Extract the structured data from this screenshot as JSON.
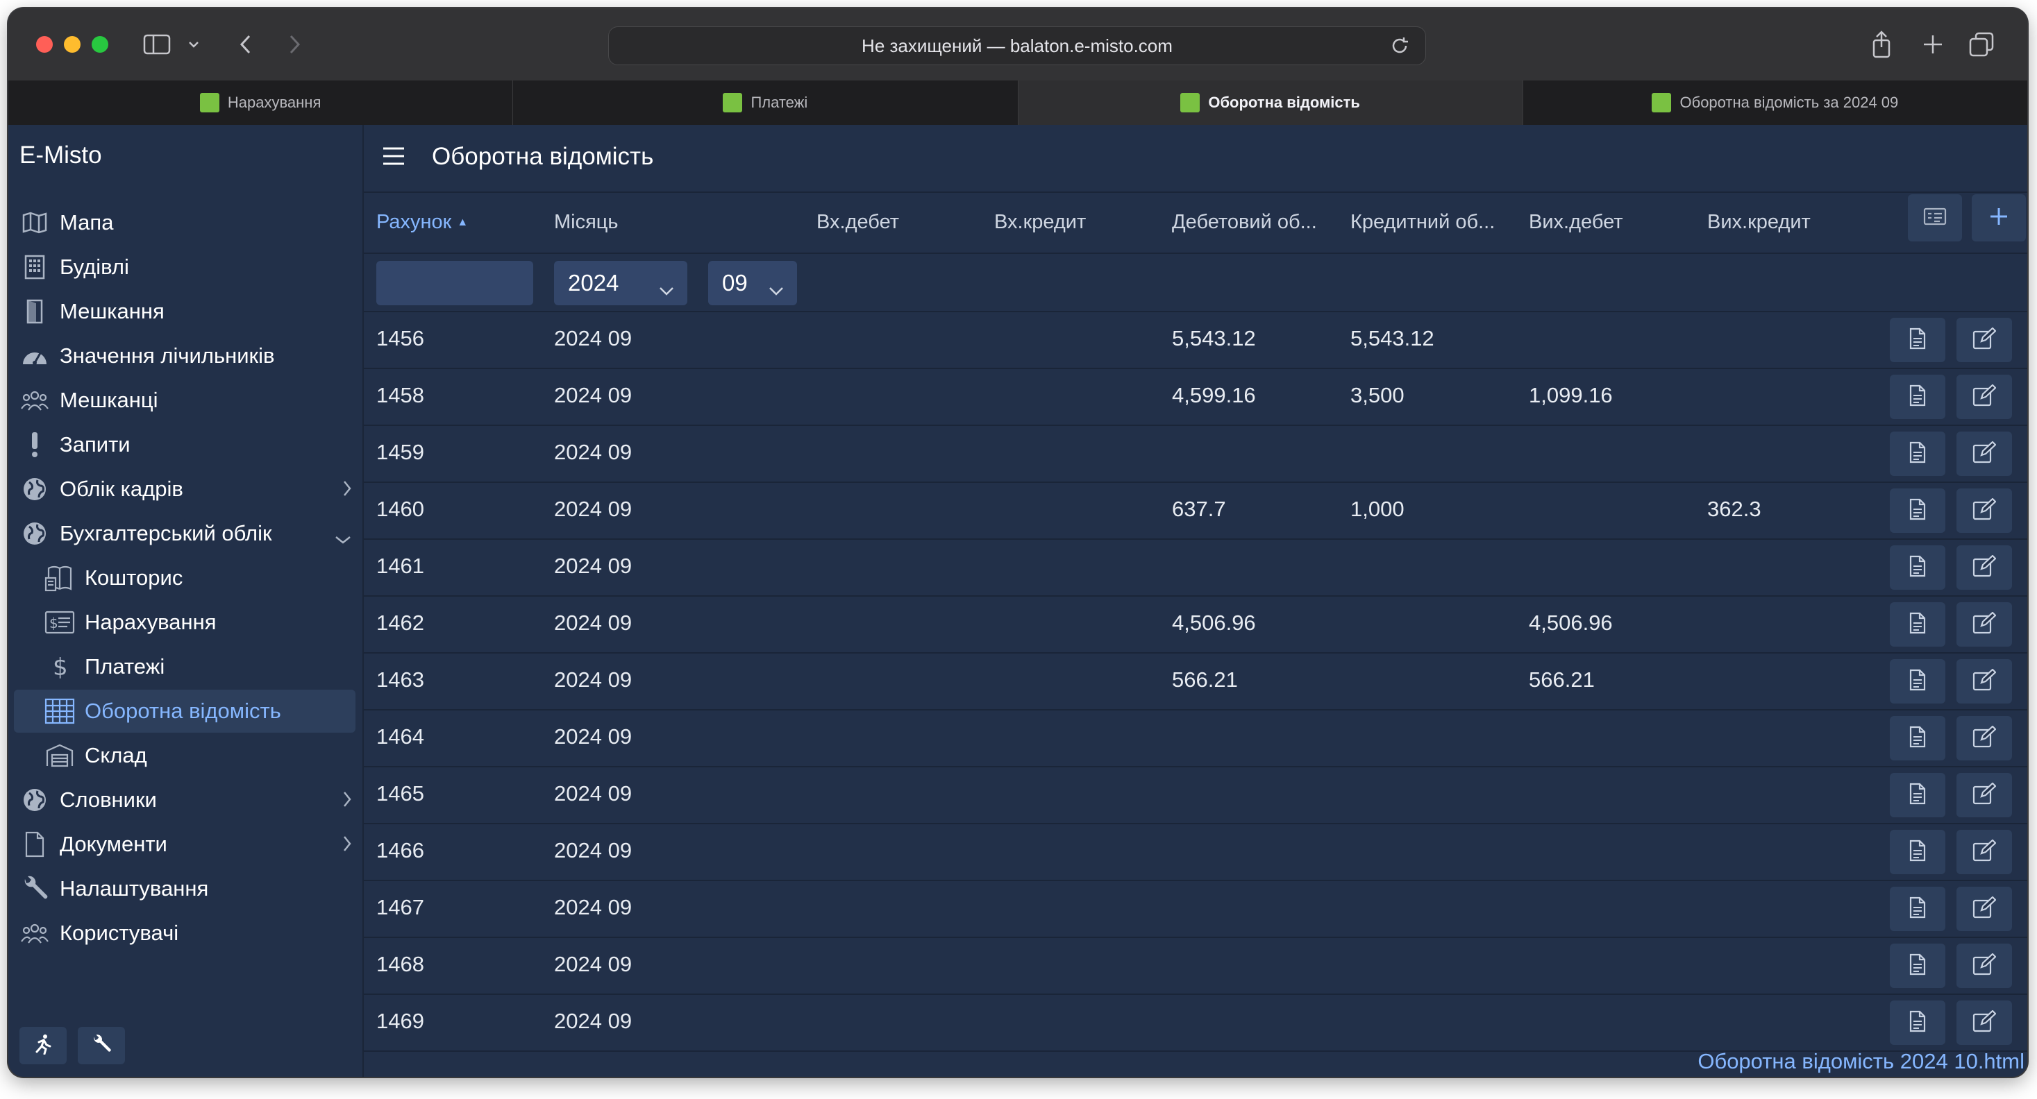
{
  "browser": {
    "url_text": "Не захищений — balaton.e-misto.com",
    "tabs": [
      {
        "label": "Нарахування",
        "active": false
      },
      {
        "label": "Платежі",
        "active": false
      },
      {
        "label": "Оборотна відомість",
        "active": true
      },
      {
        "label": "Оборотна відомість за 2024 09",
        "active": false
      }
    ]
  },
  "sidebar": {
    "brand": "E-Misto",
    "items": [
      {
        "label": "Мапа",
        "icon": "map-icon"
      },
      {
        "label": "Будівлі",
        "icon": "building-icon"
      },
      {
        "label": "Мешкання",
        "icon": "door-icon"
      },
      {
        "label": "Значення лічильників",
        "icon": "gauge-icon"
      },
      {
        "label": "Мешканці",
        "icon": "users-icon"
      },
      {
        "label": "Запити",
        "icon": "exclamation-icon"
      },
      {
        "label": "Облік кадрів",
        "icon": "globe-icon",
        "chevron": "right"
      },
      {
        "label": "Бухгалтерський облік",
        "icon": "globe-icon",
        "chevron": "down"
      },
      {
        "label": "Кошторис",
        "icon": "book-icon",
        "sub": true
      },
      {
        "label": "Нарахування",
        "icon": "invoice-icon",
        "sub": true
      },
      {
        "label": "Платежі",
        "icon": "dollar-icon",
        "sub": true
      },
      {
        "label": "Оборотна відомість",
        "icon": "table-icon",
        "sub": true,
        "active": true
      },
      {
        "label": "Склад",
        "icon": "warehouse-icon",
        "sub": true
      },
      {
        "label": "Словники",
        "icon": "globe-icon",
        "chevron": "right"
      },
      {
        "label": "Документи",
        "icon": "document-icon",
        "chevron": "right"
      },
      {
        "label": "Налаштування",
        "icon": "wrench-icon"
      },
      {
        "label": "Користувачі",
        "icon": "users-icon"
      }
    ],
    "bottom_buttons": [
      "run-icon",
      "wrench-icon"
    ]
  },
  "page": {
    "title": "Оборотна відомість",
    "columns": [
      "Рахунок",
      "Місяць",
      "Вх.дебет",
      "Вх.кредит",
      "Дебетовий об...",
      "Кредитний об...",
      "Вих.дебет",
      "Вих.кредит"
    ],
    "sorted_column": "Рахунок",
    "filters": {
      "account": "",
      "year": "2024",
      "month": "09"
    },
    "rows": [
      {
        "account": "1456",
        "month": "2024 09",
        "in_debit": "",
        "in_credit": "",
        "debit_turnover": "5,543.12",
        "credit_turnover": "5,543.12",
        "out_debit": "",
        "out_credit": ""
      },
      {
        "account": "1458",
        "month": "2024 09",
        "in_debit": "",
        "in_credit": "",
        "debit_turnover": "4,599.16",
        "credit_turnover": "3,500",
        "out_debit": "1,099.16",
        "out_credit": ""
      },
      {
        "account": "1459",
        "month": "2024 09",
        "in_debit": "",
        "in_credit": "",
        "debit_turnover": "",
        "credit_turnover": "",
        "out_debit": "",
        "out_credit": ""
      },
      {
        "account": "1460",
        "month": "2024 09",
        "in_debit": "",
        "in_credit": "",
        "debit_turnover": "637.7",
        "credit_turnover": "1,000",
        "out_debit": "",
        "out_credit": "362.3"
      },
      {
        "account": "1461",
        "month": "2024 09",
        "in_debit": "",
        "in_credit": "",
        "debit_turnover": "",
        "credit_turnover": "",
        "out_debit": "",
        "out_credit": ""
      },
      {
        "account": "1462",
        "month": "2024 09",
        "in_debit": "",
        "in_credit": "",
        "debit_turnover": "4,506.96",
        "credit_turnover": "",
        "out_debit": "4,506.96",
        "out_credit": ""
      },
      {
        "account": "1463",
        "month": "2024 09",
        "in_debit": "",
        "in_credit": "",
        "debit_turnover": "566.21",
        "credit_turnover": "",
        "out_debit": "566.21",
        "out_credit": ""
      },
      {
        "account": "1464",
        "month": "2024 09",
        "in_debit": "",
        "in_credit": "",
        "debit_turnover": "",
        "credit_turnover": "",
        "out_debit": "",
        "out_credit": ""
      },
      {
        "account": "1465",
        "month": "2024 09",
        "in_debit": "",
        "in_credit": "",
        "debit_turnover": "",
        "credit_turnover": "",
        "out_debit": "",
        "out_credit": ""
      },
      {
        "account": "1466",
        "month": "2024 09",
        "in_debit": "",
        "in_credit": "",
        "debit_turnover": "",
        "credit_turnover": "",
        "out_debit": "",
        "out_credit": ""
      },
      {
        "account": "1467",
        "month": "2024 09",
        "in_debit": "",
        "in_credit": "",
        "debit_turnover": "",
        "credit_turnover": "",
        "out_debit": "",
        "out_credit": ""
      },
      {
        "account": "1468",
        "month": "2024 09",
        "in_debit": "",
        "in_credit": "",
        "debit_turnover": "",
        "credit_turnover": "",
        "out_debit": "",
        "out_credit": ""
      },
      {
        "account": "1469",
        "month": "2024 09",
        "in_debit": "",
        "in_credit": "",
        "debit_turnover": "",
        "credit_turnover": "",
        "out_debit": "",
        "out_credit": ""
      }
    ],
    "download_link": "Оборотна відомість 2024 10.html"
  },
  "colors": {
    "background": "#223049",
    "active_item": "#2d3f5c",
    "accent": "#86b7ff",
    "favicon": "#7ac142"
  }
}
